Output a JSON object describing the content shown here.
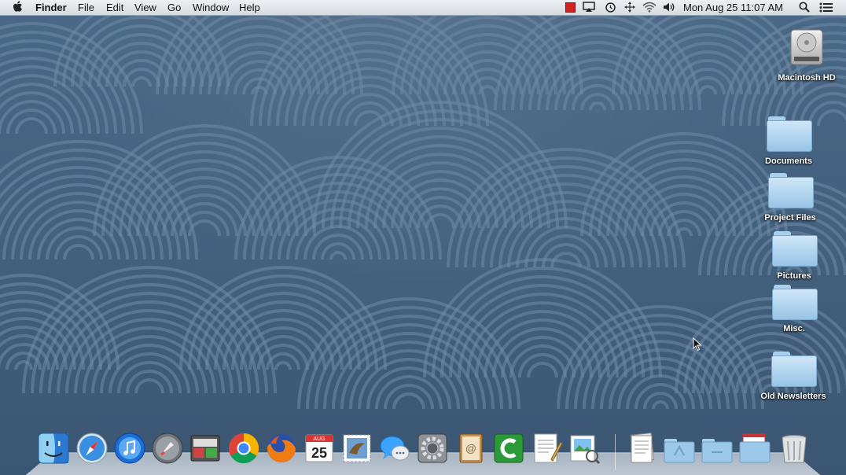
{
  "menubar": {
    "apple_icon": "apple-logo-icon",
    "app_name": "Finder",
    "menus": [
      "File",
      "Edit",
      "View",
      "Go",
      "Window",
      "Help"
    ],
    "status": {
      "icons": [
        "status-red-app-icon",
        "airplay-icon",
        "time-machine-icon",
        "move-arrows-icon",
        "wifi-icon",
        "volume-icon"
      ],
      "clock": "Mon Aug 25  11:07 AM",
      "search_icon": "spotlight-search-icon",
      "list_icon": "notification-center-icon"
    }
  },
  "desktop": {
    "icons": [
      {
        "label": "Macintosh HD",
        "kind": "drive"
      },
      {
        "label": "Documents",
        "kind": "folder"
      },
      {
        "label": "Project Files",
        "kind": "folder"
      },
      {
        "label": "Pictures",
        "kind": "folder"
      },
      {
        "label": "Misc.",
        "kind": "folder"
      },
      {
        "label": "Old Newsletters",
        "kind": "folder"
      }
    ]
  },
  "dock": {
    "apps": [
      {
        "name": "Finder",
        "icon": "finder-icon"
      },
      {
        "name": "Safari",
        "icon": "safari-icon"
      },
      {
        "name": "iTunes",
        "icon": "itunes-icon"
      },
      {
        "name": "Launchpad",
        "icon": "launchpad-icon"
      },
      {
        "name": "Photo Booth",
        "icon": "photo-app-icon"
      },
      {
        "name": "Chrome",
        "icon": "chrome-icon"
      },
      {
        "name": "Firefox",
        "icon": "firefox-icon"
      },
      {
        "name": "Calendar",
        "icon": "calendar-icon",
        "date": "25",
        "month": "AUG"
      },
      {
        "name": "Mail",
        "icon": "mail-stamp-icon"
      },
      {
        "name": "Messages",
        "icon": "messages-icon"
      },
      {
        "name": "System Preferences",
        "icon": "system-preferences-icon"
      },
      {
        "name": "Contacts",
        "icon": "contacts-icon"
      },
      {
        "name": "Camtasia",
        "icon": "camtasia-icon"
      },
      {
        "name": "TextEdit",
        "icon": "textedit-icon"
      },
      {
        "name": "Preview",
        "icon": "preview-icon"
      }
    ],
    "stacks": [
      {
        "name": "Documents stack",
        "icon": "documents-stack-icon"
      },
      {
        "name": "Applications stack",
        "icon": "applications-stack-icon"
      },
      {
        "name": "Folder stack",
        "icon": "folder-stack-icon"
      },
      {
        "name": "Downloads stack",
        "icon": "downloads-stack-icon"
      }
    ],
    "trash": {
      "name": "Trash",
      "icon": "trash-icon"
    }
  },
  "colors": {
    "wallpaper": "#45627f",
    "wallpaper_pattern": "#6f8ba6",
    "menubar": "#e4e8ec",
    "status_red": "#d32020",
    "folder": "#a9d0ec"
  }
}
